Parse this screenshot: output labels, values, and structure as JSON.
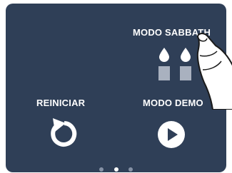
{
  "menu": {
    "sabbath_label": "MODO SABBATH",
    "reset_label": "REINICIAR",
    "demo_label": "MODO DEMO"
  },
  "icons": {
    "sabbath": "candles-icon",
    "reset": "restart-icon",
    "demo": "play-icon",
    "pointer": "hand-pointer-icon"
  },
  "pagination": {
    "total_pages": 3,
    "current_page": 2
  },
  "colors": {
    "screen_background": "#2f3f57",
    "text": "#ffffff",
    "candle_base": "#a9b1bf",
    "dot_active": "#ffffff",
    "dot_inactive": "#8591a5"
  }
}
